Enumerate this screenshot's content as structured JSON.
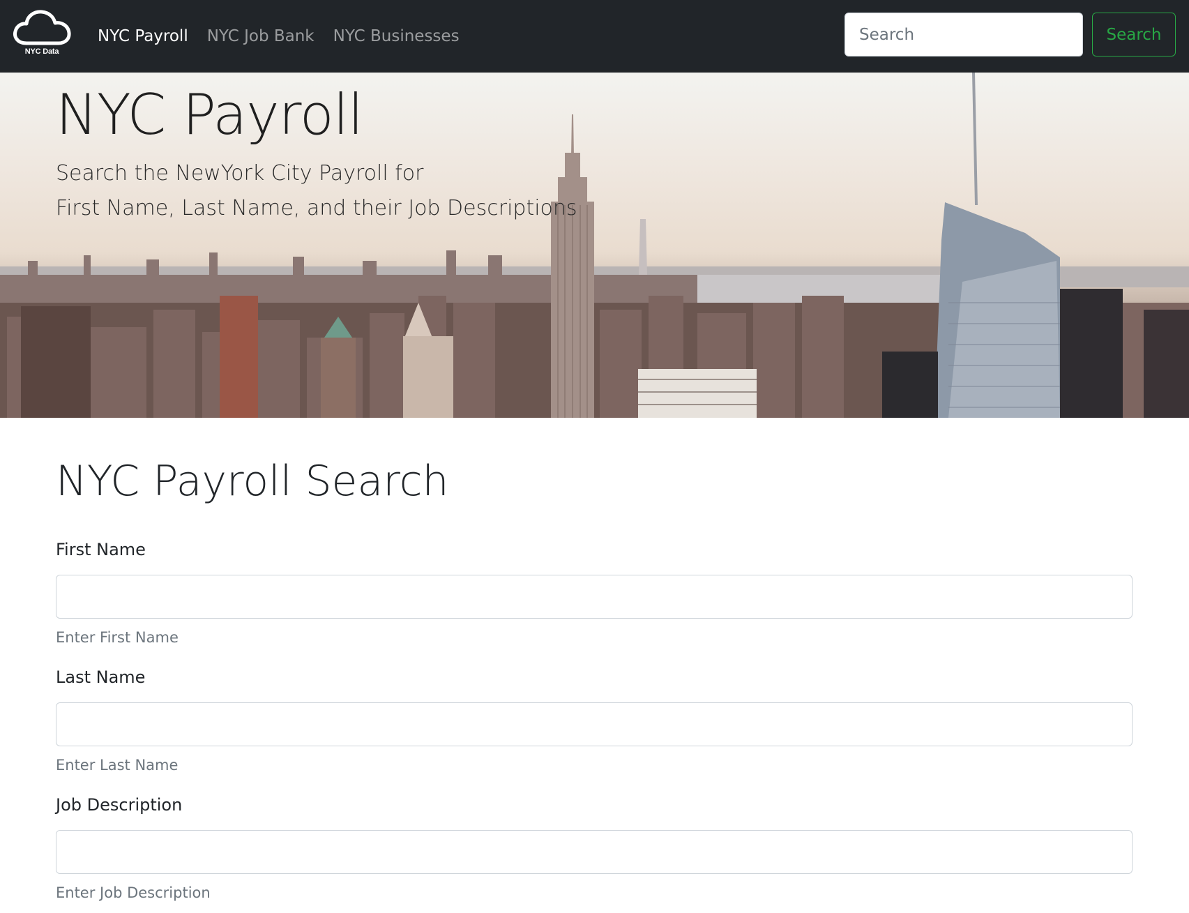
{
  "navbar": {
    "brand_text": "NYC Data",
    "links": [
      {
        "label": "NYC Payroll",
        "active": true
      },
      {
        "label": "NYC Job Bank",
        "active": false
      },
      {
        "label": "NYC Businesses",
        "active": false
      }
    ],
    "search_placeholder": "Search",
    "search_button_label": "Search"
  },
  "hero": {
    "title": "NYC Payroll",
    "subtitle_line1": "Search the NewYork City Payroll for",
    "subtitle_line2": "First Name, Last Name, and their Job Descriptions"
  },
  "form": {
    "title": "NYC Payroll Search",
    "fields": [
      {
        "label": "First Name",
        "value": "",
        "help": "Enter First Name"
      },
      {
        "label": "Last Name",
        "value": "",
        "help": "Enter Last Name"
      },
      {
        "label": "Job Description",
        "value": "",
        "help": "Enter Job Description"
      }
    ]
  },
  "colors": {
    "navbar_bg": "#212529",
    "success": "#28a745",
    "muted": "#6c757d"
  }
}
